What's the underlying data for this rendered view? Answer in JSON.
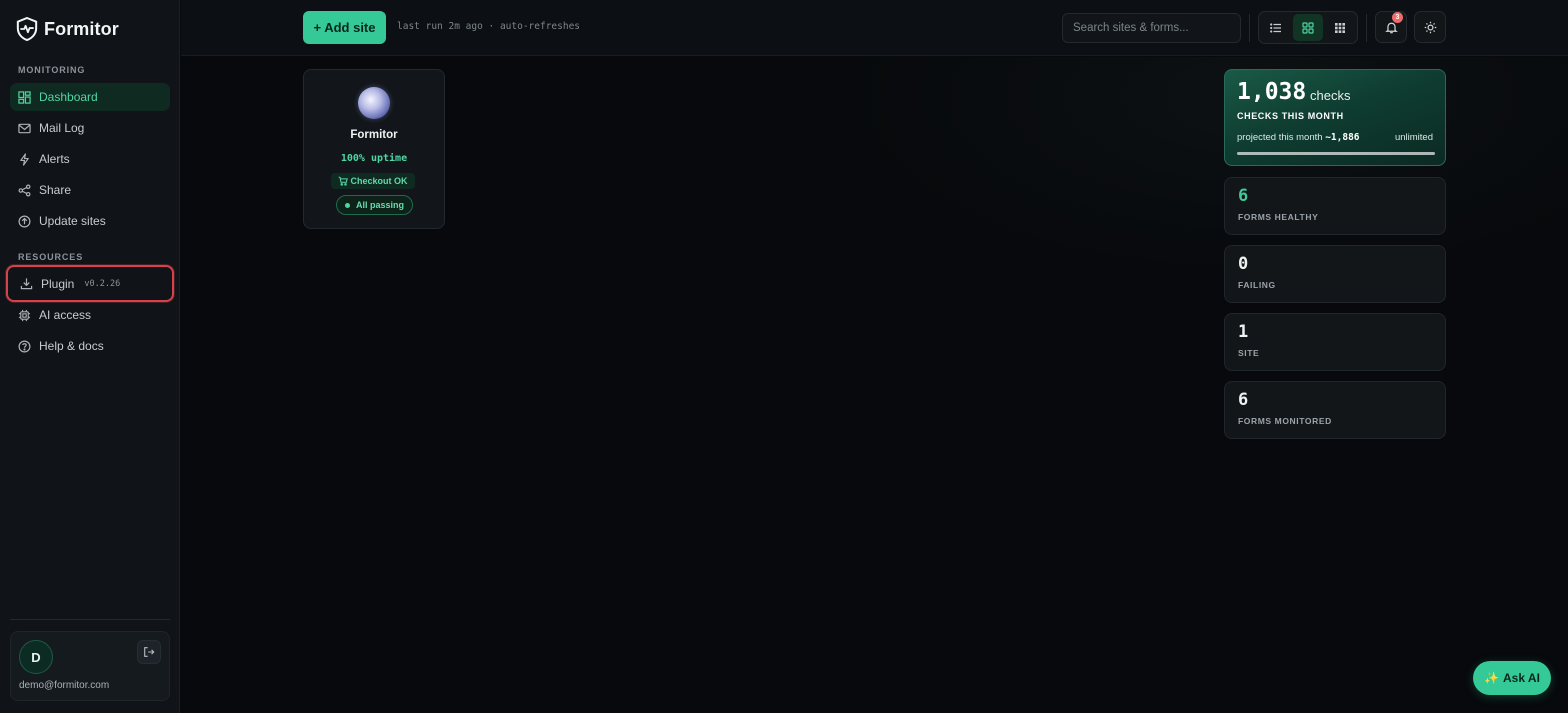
{
  "brand": {
    "name": "Formitor"
  },
  "sidebar": {
    "monitoring_label": "MONITORING",
    "monitoring_items": [
      {
        "label": "Dashboard",
        "icon": "dashboard-icon"
      },
      {
        "label": "Mail Log",
        "icon": "mail-icon"
      },
      {
        "label": "Alerts",
        "icon": "lightning-icon"
      },
      {
        "label": "Share",
        "icon": "share-icon"
      },
      {
        "label": "Update sites",
        "icon": "upload-circle-icon"
      }
    ],
    "resources_label": "RESOURCES",
    "resources_items": [
      {
        "label": "Plugin",
        "version": "v0.2.26",
        "icon": "download-icon"
      },
      {
        "label": "AI access",
        "icon": "chip-icon"
      },
      {
        "label": "Help & docs",
        "icon": "help-icon"
      }
    ],
    "user": {
      "initial": "D",
      "email": "demo@formitor.com"
    }
  },
  "topbar": {
    "add_site_label": "+ Add site",
    "last_run": "last run 2m ago · auto-refreshes",
    "search_placeholder": "Search sites & forms...",
    "notification_count": "3"
  },
  "site_card": {
    "name": "Formitor",
    "uptime": "100% uptime",
    "checkout": "Checkout OK",
    "status": "All passing"
  },
  "stats": {
    "checks_value": "1,038",
    "checks_unit": "checks",
    "checks_label": "CHECKS THIS MONTH",
    "projected_prefix": "projected this month",
    "projected_value": "~1,886",
    "plan": "unlimited",
    "usage_fraction": 1.0,
    "cards": [
      {
        "value": "6",
        "label": "FORMS HEALTHY"
      },
      {
        "value": "0",
        "label": "FAILING"
      },
      {
        "value": "1",
        "label": "SITE"
      },
      {
        "value": "6",
        "label": "FORMS MONITORED"
      }
    ]
  },
  "ask_ai_label": "Ask AI",
  "colors": {
    "accent": "#34c996",
    "alert": "#d6424c",
    "badge": "#ee6b6b"
  }
}
